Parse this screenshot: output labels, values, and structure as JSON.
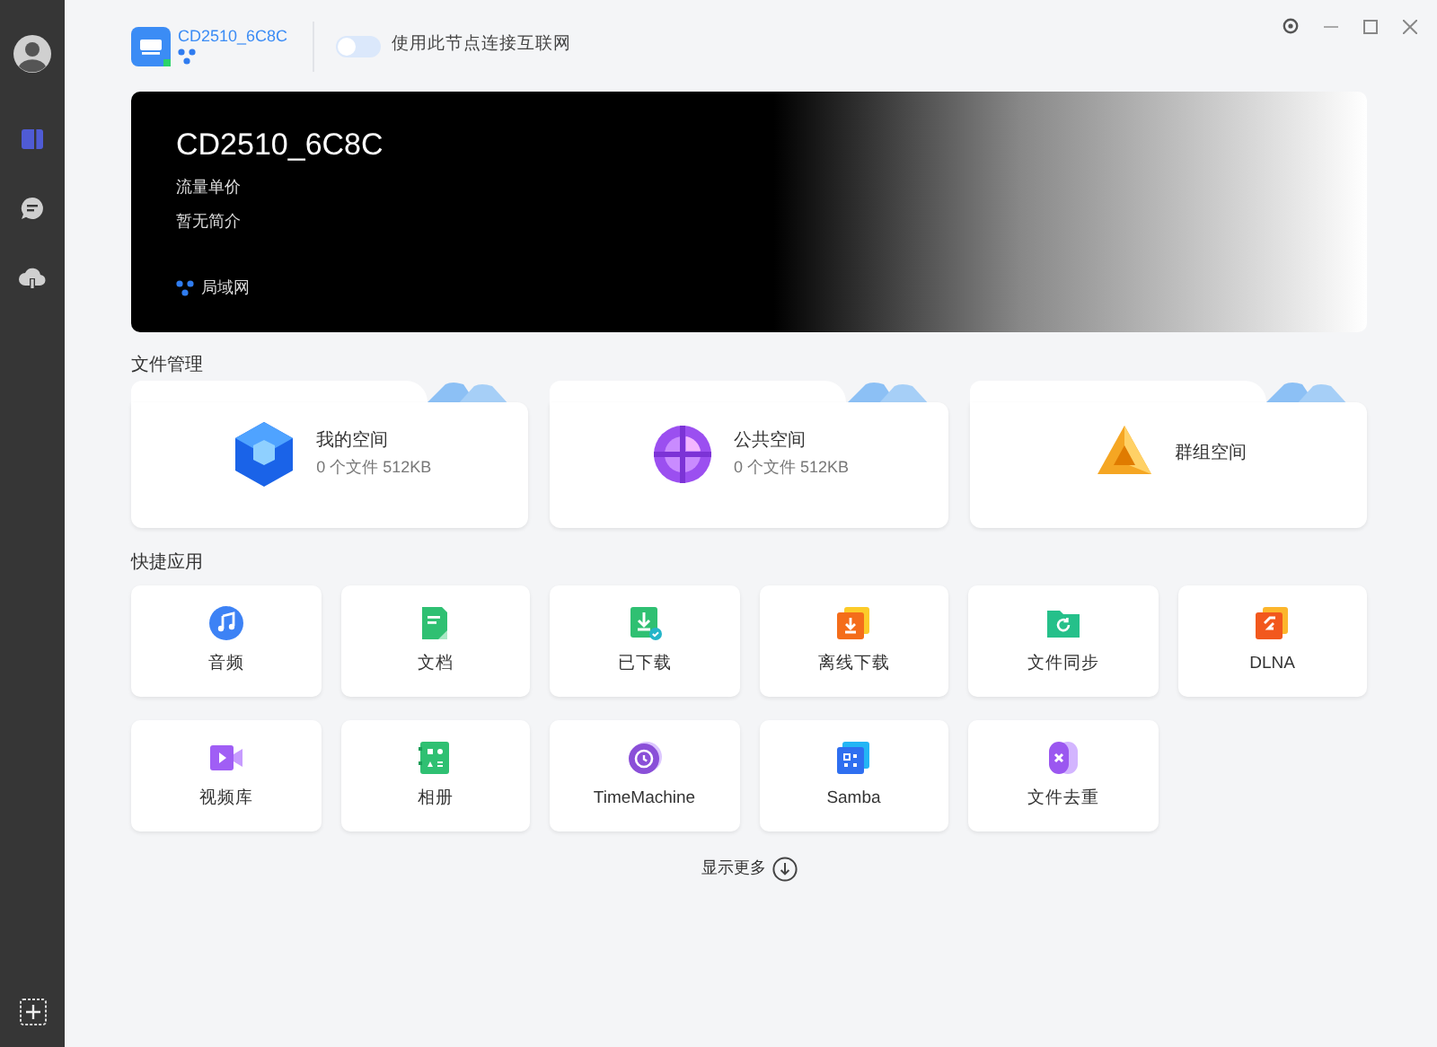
{
  "sidebar": {
    "items": [
      {
        "kind": "apps",
        "selected": true
      },
      {
        "kind": "chat",
        "selected": false
      },
      {
        "kind": "cloud",
        "selected": false
      }
    ]
  },
  "header": {
    "node_name": "CD2510_6C8C",
    "online": true,
    "toggle": {
      "label": "使用此节点连接互联网",
      "on": false
    }
  },
  "banner": {
    "title": "CD2510_6C8C",
    "lines": [
      "流量单价",
      "暂无简介"
    ],
    "network": "局域网"
  },
  "file_management": {
    "heading": "文件管理",
    "spaces": [
      {
        "kind": "cube",
        "name": "我的空间",
        "info": "0 个文件 512KB"
      },
      {
        "kind": "sphere",
        "name": "公共空间",
        "info": "0 个文件 512KB"
      },
      {
        "kind": "pyramid",
        "name": "群组空间"
      }
    ]
  },
  "quick_apps": {
    "heading": "快捷应用",
    "apps": [
      {
        "kind": "music",
        "label": "音频"
      },
      {
        "kind": "doc",
        "label": "文档"
      },
      {
        "kind": "downloaded",
        "label": "已下载"
      },
      {
        "kind": "offline",
        "label": "离线下载"
      },
      {
        "kind": "sync",
        "label": "文件同步"
      },
      {
        "kind": "dlna",
        "label": "DLNA"
      },
      {
        "kind": "video",
        "label": "视频库"
      },
      {
        "kind": "album",
        "label": "相册"
      },
      {
        "kind": "time",
        "label": "TimeMachine"
      },
      {
        "kind": "samba",
        "label": "Samba"
      },
      {
        "kind": "dedupe",
        "label": "文件去重"
      }
    ]
  },
  "show_more": "显示更多"
}
